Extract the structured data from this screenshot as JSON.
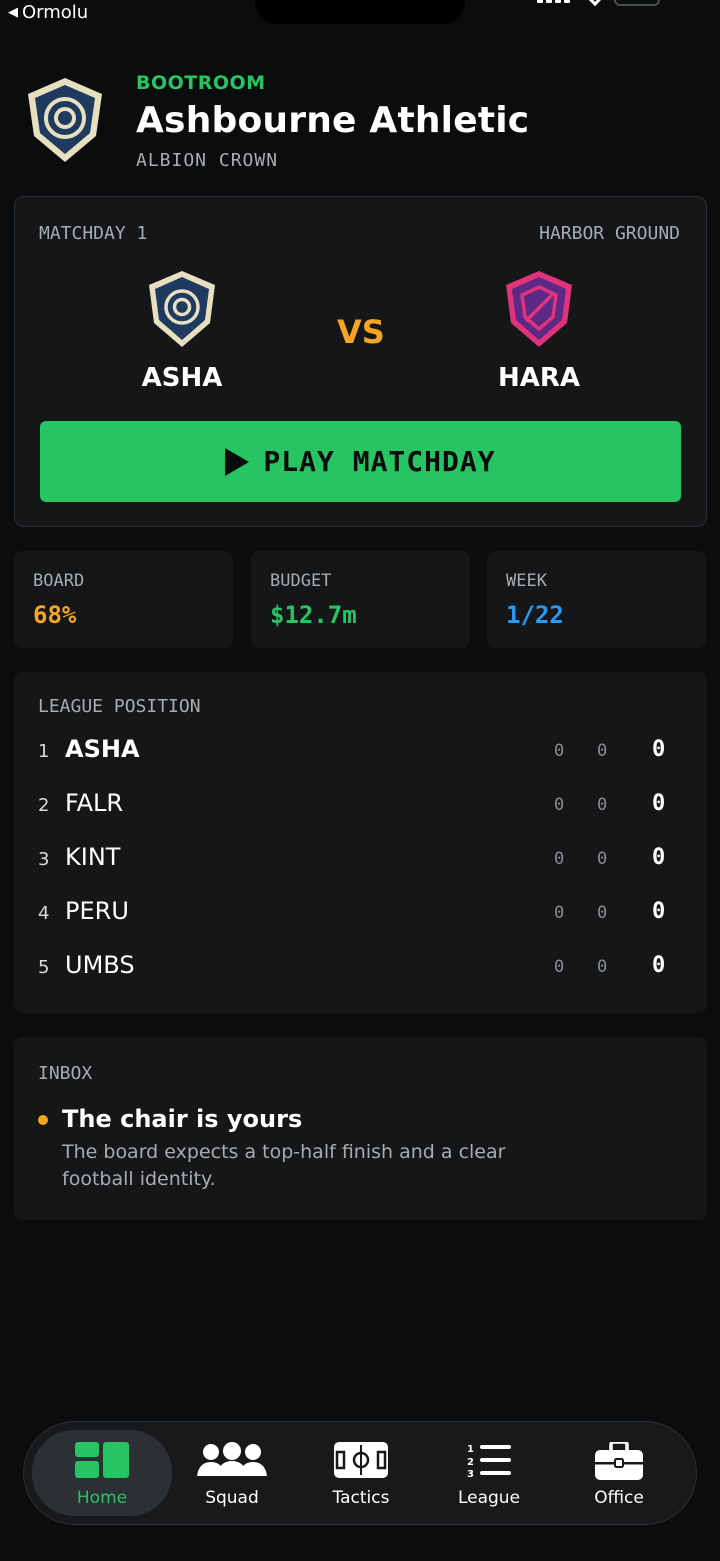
{
  "status_bar": {
    "back_app": "Ormolu"
  },
  "header": {
    "kicker": "BOOTROOM",
    "club_name": "Ashbourne Athletic",
    "league_name": "ALBION CROWN"
  },
  "match": {
    "matchday": "MATCHDAY 1",
    "venue": "HARBOR GROUND",
    "home": "ASHA",
    "away": "HARA",
    "vs": "VS",
    "play_label": "PLAY MATCHDAY"
  },
  "stats": {
    "board_label": "BOARD",
    "board_value": "68%",
    "budget_label": "BUDGET",
    "budget_value": "$12.7m",
    "week_label": "WEEK",
    "week_value": "1/22"
  },
  "league": {
    "title": "LEAGUE POSITION",
    "rows": [
      {
        "pos": "1",
        "team": "ASHA",
        "c1": "0",
        "c2": "0",
        "pts": "0"
      },
      {
        "pos": "2",
        "team": "FALR",
        "c1": "0",
        "c2": "0",
        "pts": "0"
      },
      {
        "pos": "3",
        "team": "KINT",
        "c1": "0",
        "c2": "0",
        "pts": "0"
      },
      {
        "pos": "4",
        "team": "PERU",
        "c1": "0",
        "c2": "0",
        "pts": "0"
      },
      {
        "pos": "5",
        "team": "UMBS",
        "c1": "0",
        "c2": "0",
        "pts": "0"
      }
    ]
  },
  "inbox": {
    "title": "INBOX",
    "message_title": "The chair is yours",
    "message_body": "The board expects a top-half finish and a clear football identity."
  },
  "tabs": [
    {
      "label": "Home",
      "icon": "home-grid-icon",
      "active": true
    },
    {
      "label": "Squad",
      "icon": "squad-people-icon",
      "active": false
    },
    {
      "label": "Tactics",
      "icon": "tactics-pitch-icon",
      "active": false
    },
    {
      "label": "League",
      "icon": "league-list-icon",
      "active": false
    },
    {
      "label": "Office",
      "icon": "office-briefcase-icon",
      "active": false
    }
  ],
  "colors": {
    "accent_green": "#27c463",
    "accent_amber": "#f5a524",
    "accent_blue": "#2b9bf0",
    "background": "#0b0c0e",
    "card": "#141618"
  }
}
